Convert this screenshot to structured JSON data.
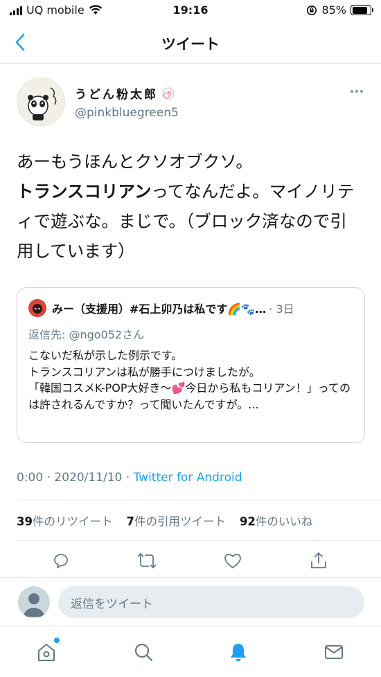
{
  "status_bar": {
    "carrier": "UQ mobile",
    "time": "19:16",
    "battery": "85%",
    "battery_level": 0.85
  },
  "nav": {
    "title": "ツイート"
  },
  "tweet": {
    "display_name": "うどん粉太郎",
    "handle": "@pinkbluegreen5",
    "text_line1": "あーもうほんとクソオブクソ。",
    "text_bold": "トランスコリアン",
    "text_rest": "ってなんだよ。マイノリティで遊ぶな。まじで。（ブロック済なので引用しています）",
    "timestamp": "0:00 · 2020/11/10 · ",
    "via": "Twitter for Android"
  },
  "quote": {
    "name": "みー（支援用）#石上卯乃は私です🌈🐾…",
    "date": "· 3日",
    "reply_to": "返信先: @ngo052さん",
    "body": "こないだ私が示した例示です。\nトランスコリアンは私が勝手につけましたが。\n「韓国コスメK-POP大好き〜💕今日から私もコリアン！」ってのは許されるんですか？って聞いたんですが。..."
  },
  "stats": {
    "retweets": "39",
    "retweets_label": "件のリツイート",
    "quotes": "7",
    "quotes_label": "件の引用ツイート",
    "likes": "92",
    "likes_label": "件のいいね"
  },
  "reply": {
    "placeholder": "返信をツイート"
  },
  "colors": {
    "accent": "#1da1f2",
    "muted": "#657786",
    "text": "#14171a"
  }
}
